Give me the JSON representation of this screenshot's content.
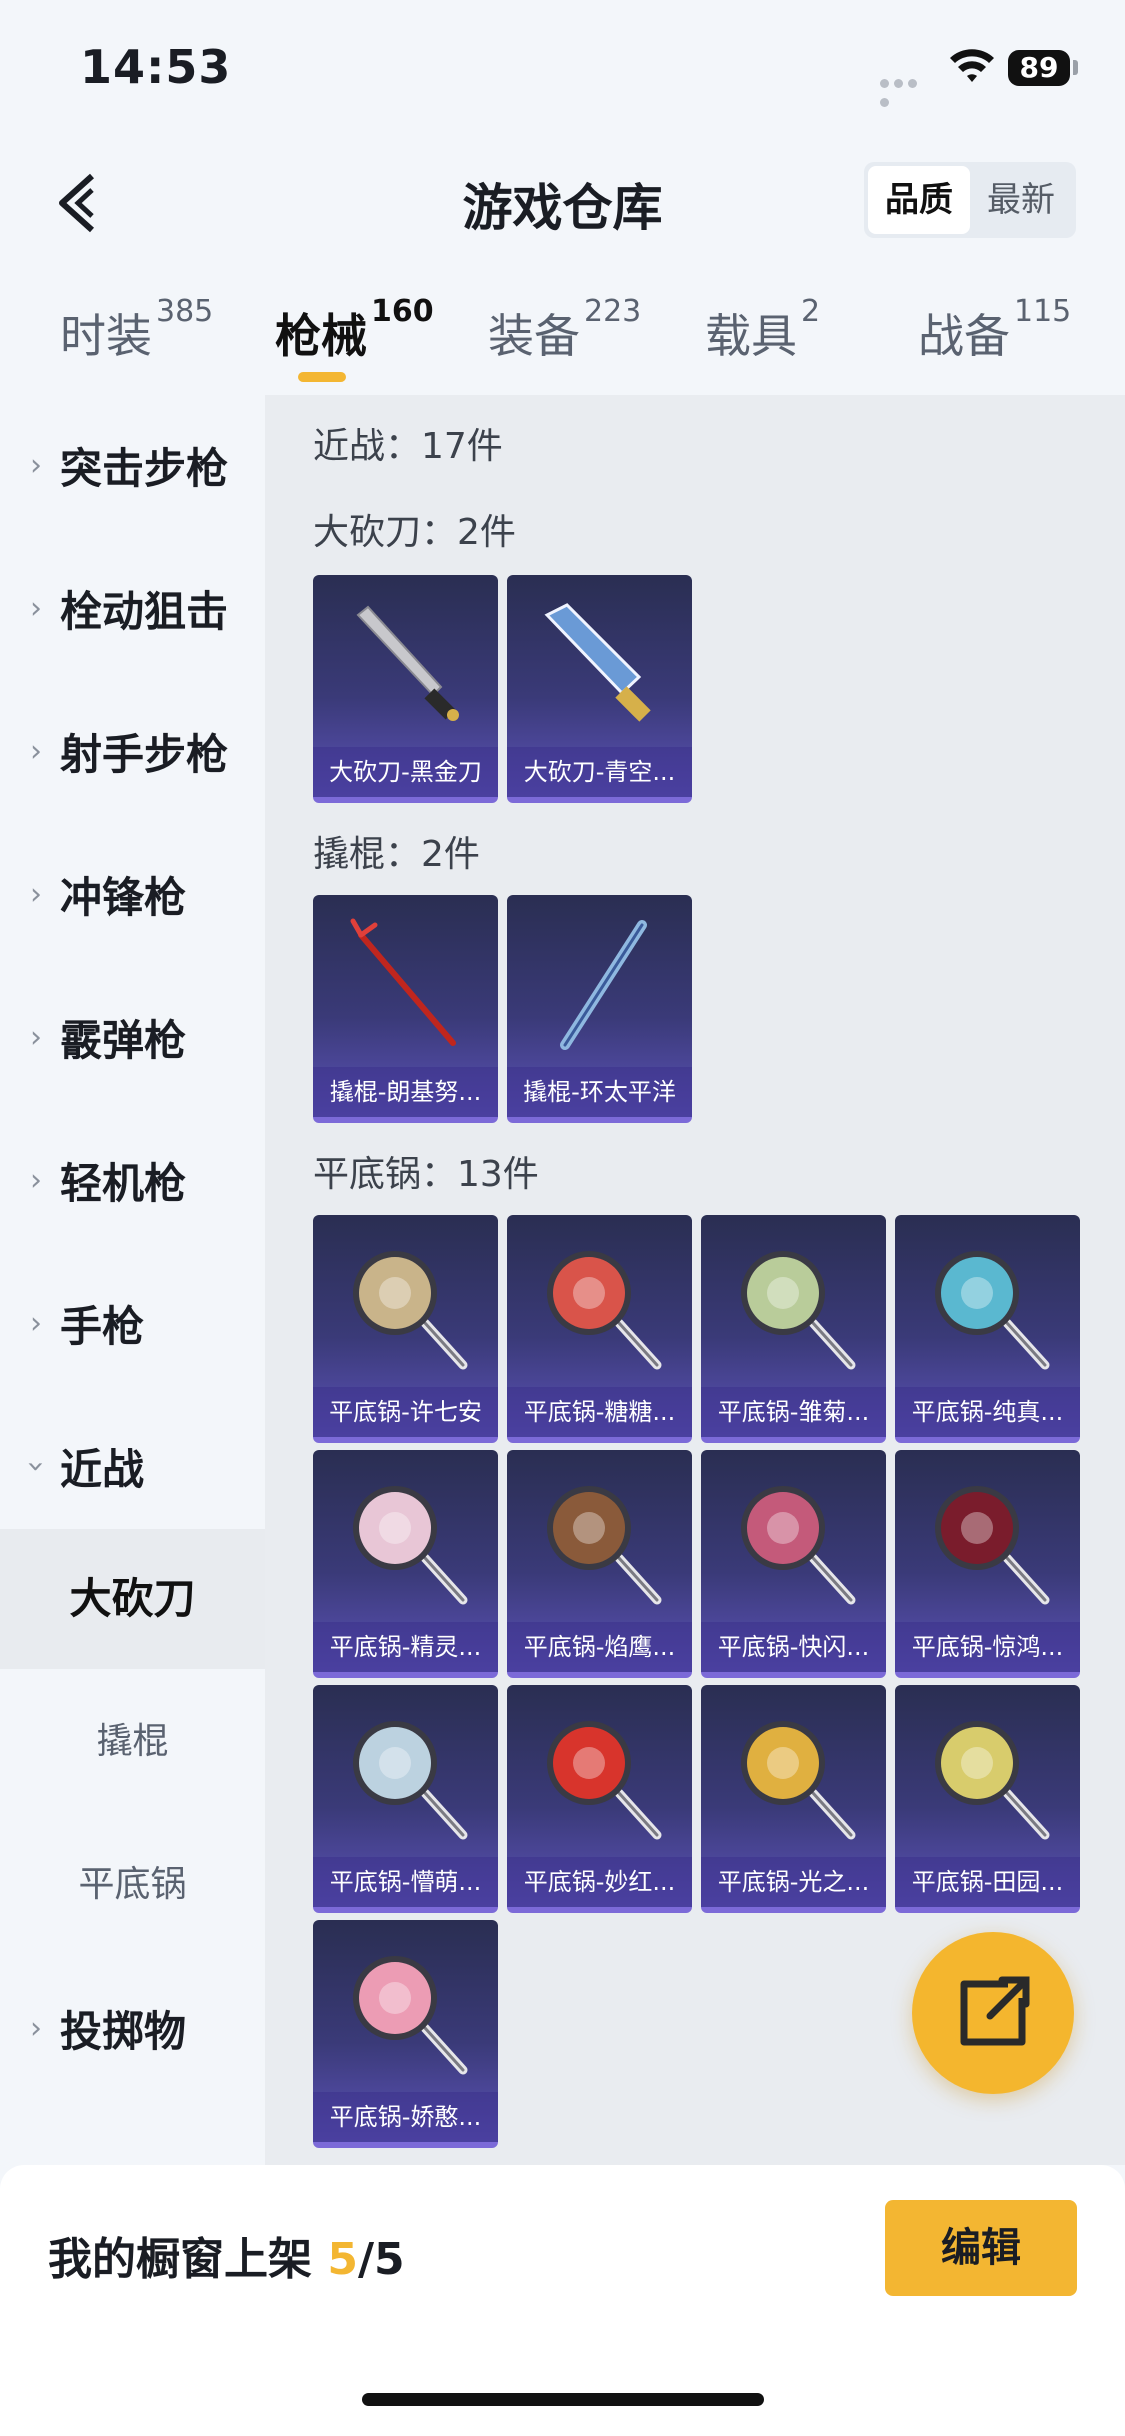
{
  "status": {
    "time": "14:53",
    "battery": "89"
  },
  "header": {
    "title": "游戏仓库",
    "sort_options": [
      "品质",
      "最新"
    ],
    "sort_active": "品质"
  },
  "tabs": [
    {
      "label": "时装",
      "count": "385"
    },
    {
      "label": "枪械",
      "count": "160"
    },
    {
      "label": "装备",
      "count": "223"
    },
    {
      "label": "载具",
      "count": "2"
    },
    {
      "label": "战备",
      "count": "115"
    }
  ],
  "active_tab": "枪械",
  "sidebar": {
    "items": [
      {
        "label": "突击步枪",
        "expanded": false
      },
      {
        "label": "栓动狙击",
        "expanded": false
      },
      {
        "label": "射手步枪",
        "expanded": false
      },
      {
        "label": "冲锋枪",
        "expanded": false
      },
      {
        "label": "霰弹枪",
        "expanded": false
      },
      {
        "label": "轻机枪",
        "expanded": false
      },
      {
        "label": "手枪",
        "expanded": false
      },
      {
        "label": "近战",
        "expanded": true
      },
      {
        "label": "投掷物",
        "expanded": false
      }
    ],
    "subitems": [
      {
        "label": "大砍刀",
        "active": true
      },
      {
        "label": "撬棍",
        "active": false
      },
      {
        "label": "平底锅",
        "active": false
      }
    ]
  },
  "content": {
    "total": "近战：17件",
    "sections": [
      {
        "title": "大砍刀：2件",
        "items": [
          {
            "name": "大砍刀-黑金刀",
            "icon": "machete-icon"
          },
          {
            "name": "大砍刀-青空...",
            "icon": "machete-icon"
          }
        ]
      },
      {
        "title": "撬棍：2件",
        "items": [
          {
            "name": "撬棍-朗基努...",
            "icon": "crowbar-icon"
          },
          {
            "name": "撬棍-环太平洋",
            "icon": "crowbar-icon"
          }
        ]
      },
      {
        "title": "平底锅：13件",
        "items": [
          {
            "name": "平底锅-许七安",
            "icon": "pan-icon",
            "color": "#c9b48a"
          },
          {
            "name": "平底锅-糖糖...",
            "icon": "pan-icon",
            "color": "#d9544a"
          },
          {
            "name": "平底锅-雏菊...",
            "icon": "pan-icon",
            "color": "#b9cc9a"
          },
          {
            "name": "平底锅-纯真...",
            "icon": "pan-icon",
            "color": "#5ab8d0"
          },
          {
            "name": "平底锅-精灵...",
            "icon": "pan-icon",
            "color": "#e8c6d6"
          },
          {
            "name": "平底锅-焰鹰...",
            "icon": "pan-icon",
            "color": "#8a5a3a"
          },
          {
            "name": "平底锅-快闪...",
            "icon": "pan-icon",
            "color": "#c45a7a"
          },
          {
            "name": "平底锅-惊鸿...",
            "icon": "pan-icon",
            "color": "#7a1c2c"
          },
          {
            "name": "平底锅-懵萌...",
            "icon": "pan-icon",
            "color": "#bcd2e0"
          },
          {
            "name": "平底锅-妙红...",
            "icon": "pan-icon",
            "color": "#d8342c"
          },
          {
            "name": "平底锅-光之...",
            "icon": "pan-icon",
            "color": "#e0b040"
          },
          {
            "name": "平底锅-田园...",
            "icon": "pan-icon",
            "color": "#d8cc6c"
          },
          {
            "name": "平底锅-娇憨...",
            "icon": "pan-icon",
            "color": "#ec9cb4"
          }
        ]
      }
    ]
  },
  "bottom": {
    "label": "我的橱窗上架",
    "count": "5",
    "total": "/5",
    "edit_label": "编辑"
  },
  "colors": {
    "accent": "#f3b632",
    "card_bg": "#3a3a78"
  }
}
